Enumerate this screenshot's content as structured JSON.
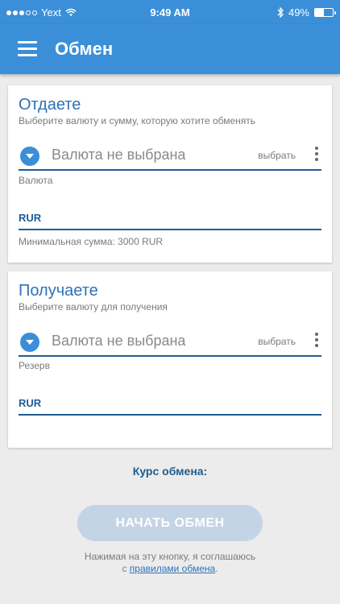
{
  "status_bar": {
    "carrier": "Yext",
    "time": "9:49 AM",
    "battery_percent": "49%",
    "battery_level": 0.49,
    "icons": [
      "signal-icon",
      "wifi-icon",
      "bluetooth-icon",
      "battery-icon"
    ]
  },
  "app_bar": {
    "title": "Обмен",
    "menu_icon": "hamburger-menu-icon"
  },
  "give": {
    "title": "Отдаете",
    "subtitle": "Выберите валюту и сумму, которую хотите обменять",
    "currency_placeholder": "Валюта не выбрана",
    "select_label": "выбрать",
    "field_label": "Валюта",
    "currency_value": "RUR",
    "min_amount_note": "Минимальная сумма: 3000 RUR"
  },
  "get": {
    "title": "Получаете",
    "subtitle": "Выберите валюту для получения",
    "currency_placeholder": "Валюта не выбрана",
    "select_label": "выбрать",
    "field_label": "Резерв",
    "currency_value": "RUR"
  },
  "rate": {
    "label": "Курс обмена:"
  },
  "actions": {
    "start_button": "НАЧАТЬ ОБМЕН"
  },
  "agreement": {
    "text": "Нажимая на эту кнопку, я соглашаюсь",
    "prefix": "с",
    "link_text": "правилами обмена",
    "suffix": "."
  },
  "colors": {
    "accent": "#3b8fd9",
    "dark_blue": "#1f5c94",
    "background": "#ececec",
    "button_disabled": "#c4d4e6"
  }
}
